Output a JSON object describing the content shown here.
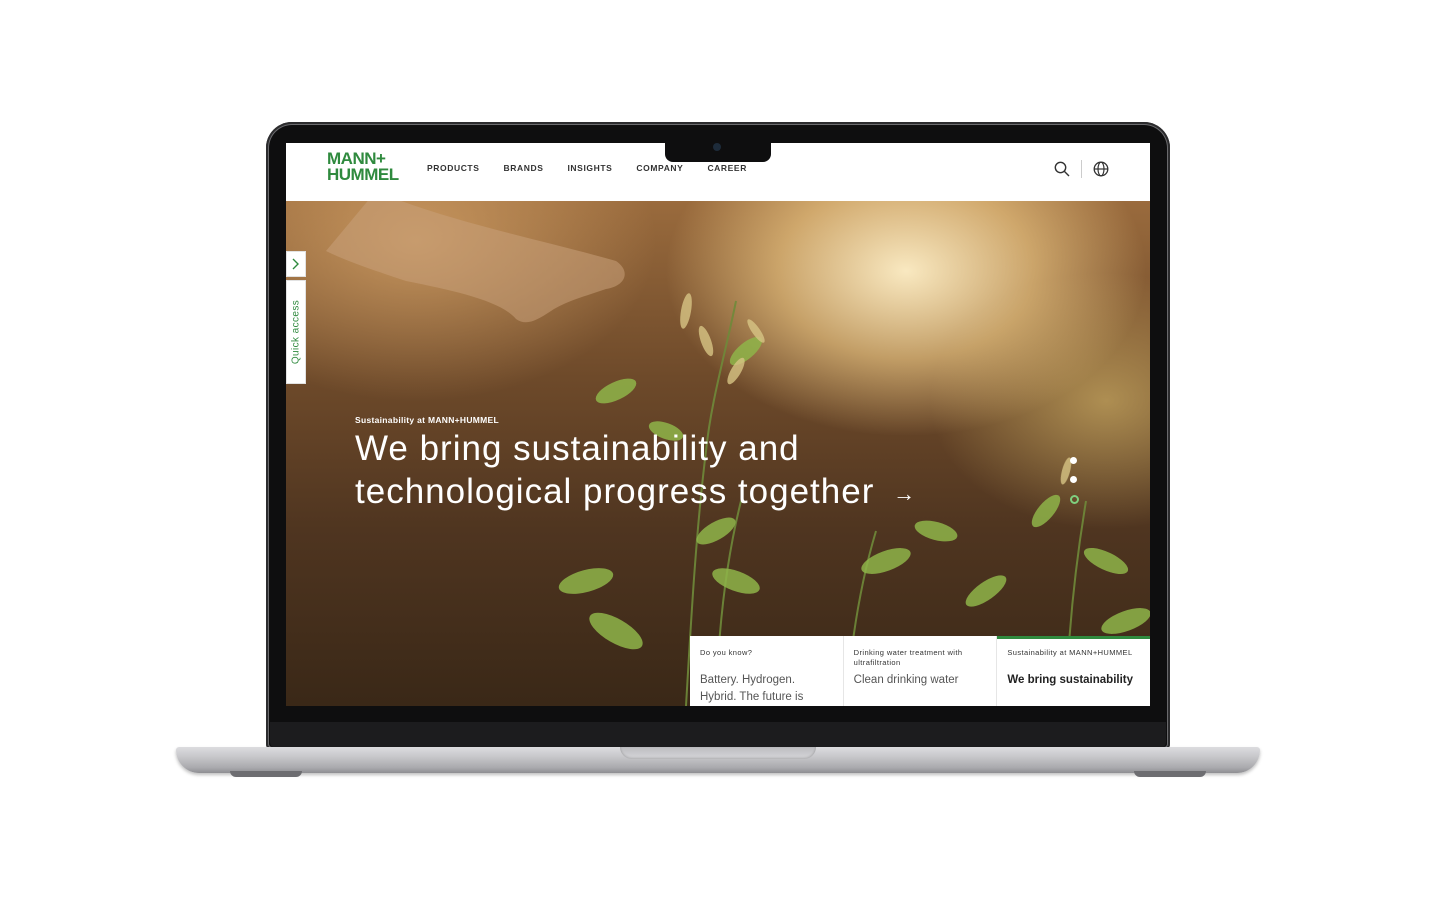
{
  "header": {
    "logo": {
      "line1": "MANN+",
      "line2": "HUMMEL"
    },
    "nav": [
      "PRODUCTS",
      "BRANDS",
      "INSIGHTS",
      "COMPANY",
      "CAREER"
    ],
    "icons": [
      "search-icon",
      "globe-icon"
    ]
  },
  "quick_access": {
    "label": "Quick access",
    "icon": "chevron-right-icon"
  },
  "hero": {
    "eyebrow": "Sustainability at MANN+HUMMEL",
    "headline_line1": "We bring sustainability and",
    "headline_line2": "technological progress together",
    "arrow": "→",
    "slides_total": 3,
    "active_slide": 3
  },
  "cards": [
    {
      "kicker": "Do you know?",
      "title": "Battery. Hydrogen. Hybrid. The future is"
    },
    {
      "kicker": "Drinking water treatment with ultrafiltration",
      "title": "Clean drinking water"
    },
    {
      "kicker": "Sustainability at MANN+HUMMEL",
      "title": "We bring sustainability"
    }
  ],
  "colors": {
    "brand_green": "#2f8a3e",
    "active_dot": "#7fd07f"
  }
}
